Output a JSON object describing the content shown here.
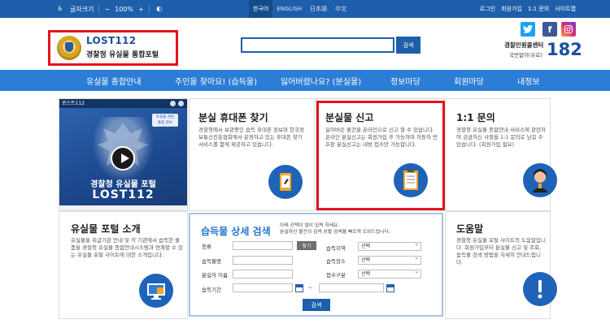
{
  "topbar": {
    "font_size_label": "글자크기",
    "font_minus": "−",
    "zoom": "100%",
    "font_plus": "+",
    "languages": [
      "한국어",
      "ENGLISH",
      "日本語",
      "中文"
    ],
    "links": [
      "로그인",
      "회원가입",
      "1:1 문의",
      "사이트맵"
    ]
  },
  "header": {
    "logo_title": "LOST112",
    "logo_subtitle": "경찰청 유실물 통합포털",
    "search_placeholder": "",
    "search_button": "검색",
    "social": [
      "twitter-icon",
      "facebook-icon",
      "instagram-icon"
    ],
    "call_center": "경찰민원콜센터",
    "call_sub": "국번없이(유료)",
    "call_number": "182"
  },
  "nav": {
    "items": [
      "유실물 종합안내",
      "주인을 찾아요! (습득물)",
      "잃어버렸나요? (분실물)",
      "정보마당",
      "회원마당",
      "내정보"
    ]
  },
  "video": {
    "header": "로스트112",
    "badge_lines": [
      "유실물 관련",
      "통합 정보",
      "시스템 소개"
    ],
    "title": "경찰청 유실물 포털",
    "title2": "LOST112"
  },
  "cards": {
    "phone": {
      "title": "분실 휴대폰 찾기",
      "desc": "경찰청에서 보관중인 습득 휴대폰 정보와 한국정보통신진흥협회에서 운영하고 있는 휴대폰 찾기 서비스를 함께 제공하고 있습니다."
    },
    "report": {
      "title": "분실물 신고",
      "desc": "잃어버린 물건을 온라인으로 신고 할 수 있습니다. 온라인 분실신고는 회원가입 후 가능하며 자동차 번호판 분실신고는 내방 접수만 가능합니다."
    },
    "inquiry": {
      "title": "1:1 문의",
      "desc": "경찰청 유실물 종합안내 서비스에 관련하여 궁금하신 사항을 1:1 문의로 남길 수 있습니다. (회원가입 필요)"
    },
    "intro": {
      "title": "유실물 포털 소개",
      "desc": "유실물을 취급기관 안내 및 각 기관에서 습득한 물품을 경찰청 유실물 종합안내시스템과 연계할 수 있는 유실물 포털 사이트에 대한 소개입니다."
    },
    "help": {
      "title": "도움말",
      "desc": "경찰청 유실물 포털 사이트의 도움말입니다. 회원가입부터 분실물 신고 및 조회, 습득물 검색 방법을 자세히 안내드립니다."
    }
  },
  "detail_search": {
    "title": "습득물 상세 검색",
    "note": [
      "아래 선택이 많이 입력 하세요.",
      "분실하신 물건의 검색 상황 검색을 빠르게 도와드립니다."
    ],
    "labels": {
      "type": "종류",
      "item_name": "습득물명",
      "loser_name": "분실자 이름",
      "period": "습득기간",
      "region": "습득지역",
      "place": "습득장소",
      "intake": "접수구분"
    },
    "find_button": "찾기",
    "select_default": "선택",
    "range_sep": "~",
    "submit": "검색"
  },
  "colors": {
    "brand_blue": "#1d5faa",
    "nav_blue": "#2c7dd6",
    "highlight_red": "#e3141e"
  }
}
